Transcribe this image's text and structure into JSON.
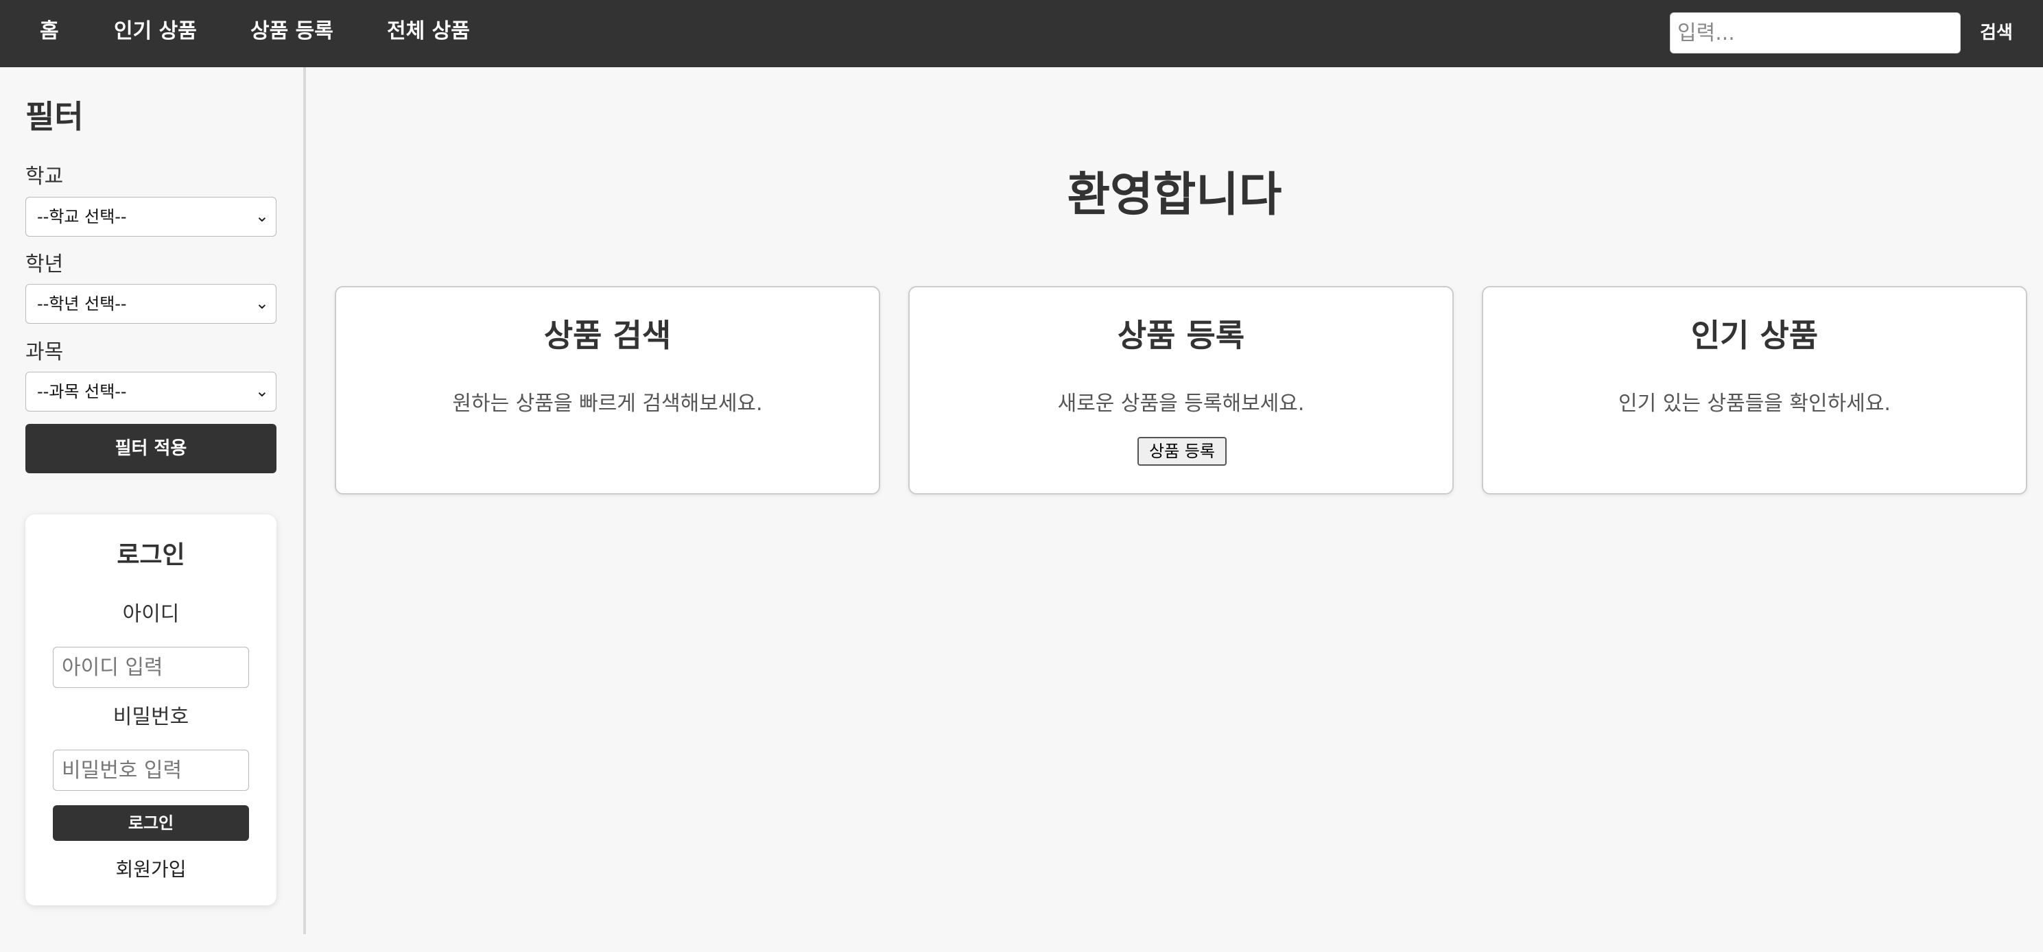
{
  "nav": {
    "items": [
      "홈",
      "인기 상품",
      "상품 등록",
      "전체 상품"
    ],
    "search_placeholder": "입력...",
    "search_button": "검색"
  },
  "sidebar": {
    "title": "필터",
    "filters": [
      {
        "label": "학교",
        "selected": "--학교 선택--"
      },
      {
        "label": "학년",
        "selected": "--학년 선택--"
      },
      {
        "label": "과목",
        "selected": "--과목 선택--"
      }
    ],
    "apply_button": "필터 적용"
  },
  "login": {
    "title": "로그인",
    "id_label": "아이디",
    "id_placeholder": "아이디 입력",
    "password_label": "비밀번호",
    "password_placeholder": "비밀번호 입력",
    "login_button": "로그인",
    "signup_link": "회원가입"
  },
  "main": {
    "welcome": "환영합니다",
    "cards": [
      {
        "title": "상품 검색",
        "description": "원하는 상품을 빠르게 검색해보세요."
      },
      {
        "title": "상품 등록",
        "description": "새로운 상품을 등록해보세요.",
        "button": "상품 등록"
      },
      {
        "title": "인기 상품",
        "description": "인기 있는 상품들을 확인하세요."
      }
    ]
  }
}
